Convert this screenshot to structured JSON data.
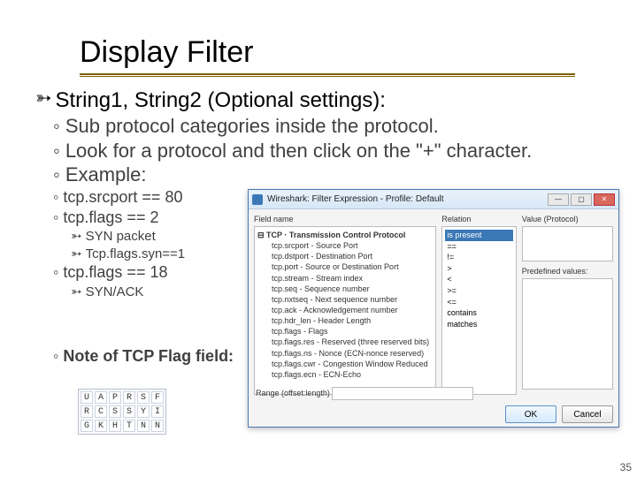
{
  "title": "Display Filter",
  "main_bullet": "String1, String2 (Optional settings):",
  "subs": [
    "Sub protocol categories inside the protocol.",
    "Look for a protocol and then click on the \"+\" character.",
    "Example:"
  ],
  "examples": [
    "tcp.srcport == 80",
    "tcp.flags == 2",
    "tcp.flags == 18"
  ],
  "detail1": [
    "SYN packet",
    "Tcp.flags.syn==1"
  ],
  "detail2": [
    "SYN/ACK"
  ],
  "note": "Note of TCP Flag field:",
  "dialog": {
    "title": "Wireshark: Filter Expression - Profile: Default",
    "col_field": "Field name",
    "col_rel": "Relation",
    "col_val": "Value (Protocol)",
    "col_predef": "Predefined values:",
    "range_label": "Range (offset:length)",
    "tcp_header": "TCP · Transmission Control Protocol",
    "fields": [
      "tcp.srcport - Source Port",
      "tcp.dstport - Destination Port",
      "tcp.port - Source or Destination Port",
      "tcp.stream - Stream index",
      "tcp.seq - Sequence number",
      "tcp.nxtseq - Next sequence number",
      "tcp.ack - Acknowledgement number",
      "tcp.hdr_len - Header Length",
      "tcp.flags - Flags",
      "tcp.flags.res - Reserved (three reserved bits)",
      "tcp.flags.ns - Nonce (ECN-nonce reserved)",
      "tcp.flags.cwr - Congestion Window Reduced",
      "tcp.flags.ecn - ECN-Echo"
    ],
    "relations": [
      "is present",
      "==",
      "!=",
      ">",
      "<",
      ">=",
      "<=",
      "contains",
      "matches"
    ],
    "ok": "OK",
    "cancel": "Cancel"
  },
  "flaggrid": [
    [
      "U",
      "A",
      "P",
      "R",
      "S",
      "F"
    ],
    [
      "R",
      "C",
      "S",
      "S",
      "Y",
      "I"
    ],
    [
      "G",
      "K",
      "H",
      "T",
      "N",
      "N"
    ]
  ],
  "page": "35"
}
